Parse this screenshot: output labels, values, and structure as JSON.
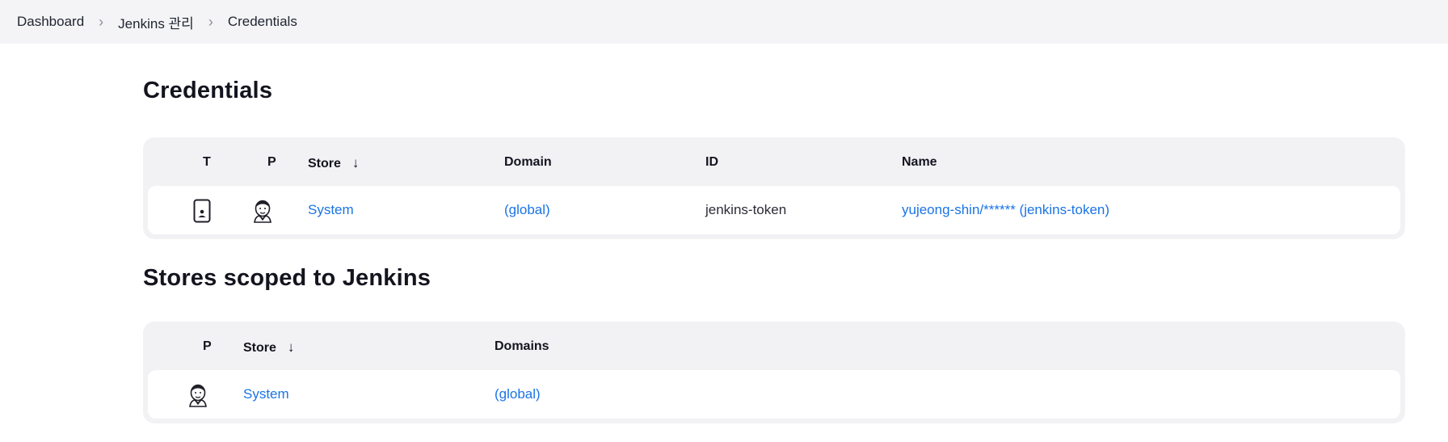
{
  "breadcrumb": {
    "items": [
      {
        "label": "Dashboard"
      },
      {
        "label": "Jenkins 관리"
      },
      {
        "label": "Credentials"
      }
    ]
  },
  "credentials_section": {
    "title": "Credentials",
    "headers": {
      "t": "T",
      "p": "P",
      "store": "Store",
      "domain": "Domain",
      "id": "ID",
      "name": "Name"
    },
    "sort_indicator": "↓",
    "rows": [
      {
        "type_icon": "mobile-credential-icon",
        "provider_icon": "jenkins-butler-icon",
        "store": "System",
        "domain": "(global)",
        "id": "jenkins-token",
        "name": "yujeong-shin/****** (jenkins-token)"
      }
    ]
  },
  "stores_section": {
    "title": "Stores scoped to Jenkins",
    "headers": {
      "p": "P",
      "store": "Store",
      "domains": "Domains"
    },
    "sort_indicator": "↓",
    "rows": [
      {
        "provider_icon": "jenkins-butler-icon",
        "store": "System",
        "domains": "(global)"
      }
    ]
  },
  "colors": {
    "link": "#1b74e4",
    "breadcrumb_bg": "#f4f4f6",
    "card_bg": "#f2f2f5"
  }
}
